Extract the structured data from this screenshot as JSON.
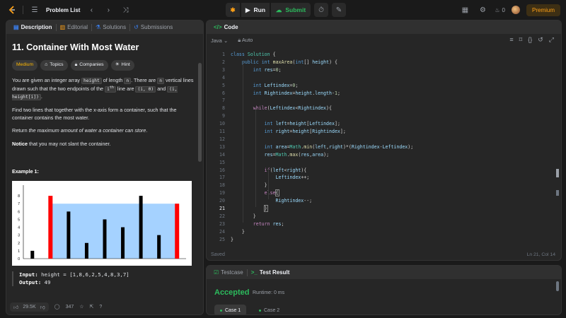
{
  "topbar": {
    "problem_list": "Problem List",
    "run": "Run",
    "submit": "Submit",
    "streak": "0",
    "premium": "Premium"
  },
  "desc_tabs": [
    "Description",
    "Editorial",
    "Solutions",
    "Submissions"
  ],
  "problem": {
    "title": "11. Container With Most Water",
    "tags": [
      "Medium",
      "Topics",
      "Companies",
      "Hint"
    ],
    "p1_a": "You are given an integer array ",
    "p1_code1": "height",
    "p1_b": " of length ",
    "p1_code2": "n",
    "p1_c": ". There are ",
    "p1_code3": "n",
    "p1_d": " vertical lines drawn such that the two endpoints of the ",
    "p1_code4": "i",
    "p1_sup": "th",
    "p1_e": " line are ",
    "p1_code5": "(i, 0)",
    "p1_f": " and ",
    "p1_code6": "(i, height[i])",
    "p1_g": ".",
    "p2": "Find two lines that together with the x-axis form a container, such that the container contains the most water.",
    "p3_a": "Return ",
    "p3_b": "the maximum amount of water a container can store",
    "p3_c": ".",
    "p4_a": "Notice",
    "p4_b": " that you may not slant the container.",
    "example_title": "Example 1:",
    "input_label": "Input:",
    "input_value": "height = [1,8,6,2,5,4,8,3,7]",
    "output_label": "Output:",
    "output_value": "49"
  },
  "chart_data": {
    "type": "bar",
    "values": [
      1,
      8,
      6,
      2,
      5,
      4,
      8,
      3,
      7
    ],
    "highlight_indices": [
      1,
      8
    ],
    "water_level": 7,
    "ylim": [
      0,
      9
    ],
    "yticks": [
      "0",
      "1",
      "2",
      "3",
      "4",
      "5",
      "6",
      "7",
      "8"
    ],
    "colors": {
      "bar": "#000000",
      "highlight": "#ff0000",
      "water": "#a5d2ff"
    }
  },
  "footer": {
    "likes": "29.5K",
    "comments": "347"
  },
  "code_panel": {
    "title": "Code",
    "language": "Java",
    "auto": "Auto",
    "status": "Saved",
    "position": "Ln 21, Col 14",
    "current_line": 21
  },
  "result_panel": {
    "tab1": "Testcase",
    "tab2": "Test Result",
    "verdict": "Accepted",
    "runtime": "Runtime: 0 ms",
    "cases": [
      "Case 1",
      "Case 2"
    ]
  },
  "colors": {
    "accent": "#ffa116",
    "success": "#2cbb5d"
  }
}
